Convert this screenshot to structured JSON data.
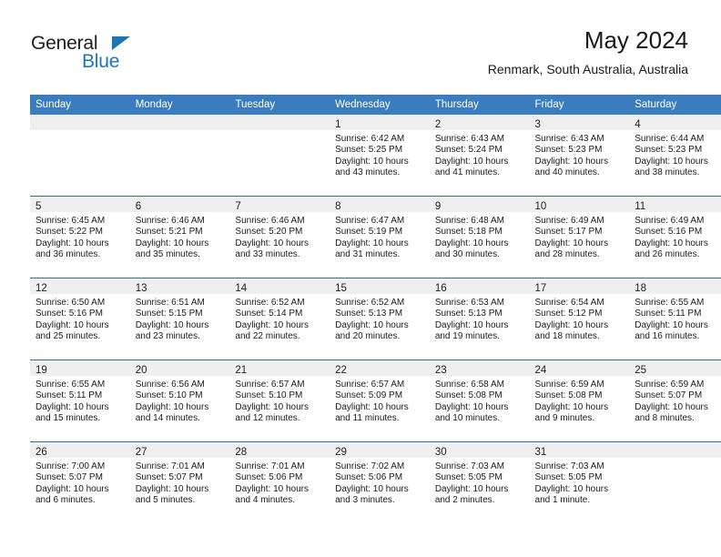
{
  "brand": {
    "name_part1": "General",
    "name_part2": "Blue",
    "logo_icon": "triangle-flag-icon",
    "accent_color": "#1b75bb"
  },
  "header": {
    "month_title": "May 2024",
    "location": "Renmark, South Australia, Australia"
  },
  "theme": {
    "header_row_bg": "#3a7cbe",
    "row_divider": "#2e6da4",
    "daynum_band_bg": "#efefef"
  },
  "calendar": {
    "weekday_headers": [
      "Sunday",
      "Monday",
      "Tuesday",
      "Wednesday",
      "Thursday",
      "Friday",
      "Saturday"
    ],
    "weeks": [
      [
        {
          "day": "",
          "sunrise": "",
          "sunset": "",
          "daylight_line1": "",
          "daylight_line2": ""
        },
        {
          "day": "",
          "sunrise": "",
          "sunset": "",
          "daylight_line1": "",
          "daylight_line2": ""
        },
        {
          "day": "",
          "sunrise": "",
          "sunset": "",
          "daylight_line1": "",
          "daylight_line2": ""
        },
        {
          "day": "1",
          "sunrise": "Sunrise: 6:42 AM",
          "sunset": "Sunset: 5:25 PM",
          "daylight_line1": "Daylight: 10 hours",
          "daylight_line2": "and 43 minutes."
        },
        {
          "day": "2",
          "sunrise": "Sunrise: 6:43 AM",
          "sunset": "Sunset: 5:24 PM",
          "daylight_line1": "Daylight: 10 hours",
          "daylight_line2": "and 41 minutes."
        },
        {
          "day": "3",
          "sunrise": "Sunrise: 6:43 AM",
          "sunset": "Sunset: 5:23 PM",
          "daylight_line1": "Daylight: 10 hours",
          "daylight_line2": "and 40 minutes."
        },
        {
          "day": "4",
          "sunrise": "Sunrise: 6:44 AM",
          "sunset": "Sunset: 5:23 PM",
          "daylight_line1": "Daylight: 10 hours",
          "daylight_line2": "and 38 minutes."
        }
      ],
      [
        {
          "day": "5",
          "sunrise": "Sunrise: 6:45 AM",
          "sunset": "Sunset: 5:22 PM",
          "daylight_line1": "Daylight: 10 hours",
          "daylight_line2": "and 36 minutes."
        },
        {
          "day": "6",
          "sunrise": "Sunrise: 6:46 AM",
          "sunset": "Sunset: 5:21 PM",
          "daylight_line1": "Daylight: 10 hours",
          "daylight_line2": "and 35 minutes."
        },
        {
          "day": "7",
          "sunrise": "Sunrise: 6:46 AM",
          "sunset": "Sunset: 5:20 PM",
          "daylight_line1": "Daylight: 10 hours",
          "daylight_line2": "and 33 minutes."
        },
        {
          "day": "8",
          "sunrise": "Sunrise: 6:47 AM",
          "sunset": "Sunset: 5:19 PM",
          "daylight_line1": "Daylight: 10 hours",
          "daylight_line2": "and 31 minutes."
        },
        {
          "day": "9",
          "sunrise": "Sunrise: 6:48 AM",
          "sunset": "Sunset: 5:18 PM",
          "daylight_line1": "Daylight: 10 hours",
          "daylight_line2": "and 30 minutes."
        },
        {
          "day": "10",
          "sunrise": "Sunrise: 6:49 AM",
          "sunset": "Sunset: 5:17 PM",
          "daylight_line1": "Daylight: 10 hours",
          "daylight_line2": "and 28 minutes."
        },
        {
          "day": "11",
          "sunrise": "Sunrise: 6:49 AM",
          "sunset": "Sunset: 5:16 PM",
          "daylight_line1": "Daylight: 10 hours",
          "daylight_line2": "and 26 minutes."
        }
      ],
      [
        {
          "day": "12",
          "sunrise": "Sunrise: 6:50 AM",
          "sunset": "Sunset: 5:16 PM",
          "daylight_line1": "Daylight: 10 hours",
          "daylight_line2": "and 25 minutes."
        },
        {
          "day": "13",
          "sunrise": "Sunrise: 6:51 AM",
          "sunset": "Sunset: 5:15 PM",
          "daylight_line1": "Daylight: 10 hours",
          "daylight_line2": "and 23 minutes."
        },
        {
          "day": "14",
          "sunrise": "Sunrise: 6:52 AM",
          "sunset": "Sunset: 5:14 PM",
          "daylight_line1": "Daylight: 10 hours",
          "daylight_line2": "and 22 minutes."
        },
        {
          "day": "15",
          "sunrise": "Sunrise: 6:52 AM",
          "sunset": "Sunset: 5:13 PM",
          "daylight_line1": "Daylight: 10 hours",
          "daylight_line2": "and 20 minutes."
        },
        {
          "day": "16",
          "sunrise": "Sunrise: 6:53 AM",
          "sunset": "Sunset: 5:13 PM",
          "daylight_line1": "Daylight: 10 hours",
          "daylight_line2": "and 19 minutes."
        },
        {
          "day": "17",
          "sunrise": "Sunrise: 6:54 AM",
          "sunset": "Sunset: 5:12 PM",
          "daylight_line1": "Daylight: 10 hours",
          "daylight_line2": "and 18 minutes."
        },
        {
          "day": "18",
          "sunrise": "Sunrise: 6:55 AM",
          "sunset": "Sunset: 5:11 PM",
          "daylight_line1": "Daylight: 10 hours",
          "daylight_line2": "and 16 minutes."
        }
      ],
      [
        {
          "day": "19",
          "sunrise": "Sunrise: 6:55 AM",
          "sunset": "Sunset: 5:11 PM",
          "daylight_line1": "Daylight: 10 hours",
          "daylight_line2": "and 15 minutes."
        },
        {
          "day": "20",
          "sunrise": "Sunrise: 6:56 AM",
          "sunset": "Sunset: 5:10 PM",
          "daylight_line1": "Daylight: 10 hours",
          "daylight_line2": "and 14 minutes."
        },
        {
          "day": "21",
          "sunrise": "Sunrise: 6:57 AM",
          "sunset": "Sunset: 5:10 PM",
          "daylight_line1": "Daylight: 10 hours",
          "daylight_line2": "and 12 minutes."
        },
        {
          "day": "22",
          "sunrise": "Sunrise: 6:57 AM",
          "sunset": "Sunset: 5:09 PM",
          "daylight_line1": "Daylight: 10 hours",
          "daylight_line2": "and 11 minutes."
        },
        {
          "day": "23",
          "sunrise": "Sunrise: 6:58 AM",
          "sunset": "Sunset: 5:08 PM",
          "daylight_line1": "Daylight: 10 hours",
          "daylight_line2": "and 10 minutes."
        },
        {
          "day": "24",
          "sunrise": "Sunrise: 6:59 AM",
          "sunset": "Sunset: 5:08 PM",
          "daylight_line1": "Daylight: 10 hours",
          "daylight_line2": "and 9 minutes."
        },
        {
          "day": "25",
          "sunrise": "Sunrise: 6:59 AM",
          "sunset": "Sunset: 5:07 PM",
          "daylight_line1": "Daylight: 10 hours",
          "daylight_line2": "and 8 minutes."
        }
      ],
      [
        {
          "day": "26",
          "sunrise": "Sunrise: 7:00 AM",
          "sunset": "Sunset: 5:07 PM",
          "daylight_line1": "Daylight: 10 hours",
          "daylight_line2": "and 6 minutes."
        },
        {
          "day": "27",
          "sunrise": "Sunrise: 7:01 AM",
          "sunset": "Sunset: 5:07 PM",
          "daylight_line1": "Daylight: 10 hours",
          "daylight_line2": "and 5 minutes."
        },
        {
          "day": "28",
          "sunrise": "Sunrise: 7:01 AM",
          "sunset": "Sunset: 5:06 PM",
          "daylight_line1": "Daylight: 10 hours",
          "daylight_line2": "and 4 minutes."
        },
        {
          "day": "29",
          "sunrise": "Sunrise: 7:02 AM",
          "sunset": "Sunset: 5:06 PM",
          "daylight_line1": "Daylight: 10 hours",
          "daylight_line2": "and 3 minutes."
        },
        {
          "day": "30",
          "sunrise": "Sunrise: 7:03 AM",
          "sunset": "Sunset: 5:05 PM",
          "daylight_line1": "Daylight: 10 hours",
          "daylight_line2": "and 2 minutes."
        },
        {
          "day": "31",
          "sunrise": "Sunrise: 7:03 AM",
          "sunset": "Sunset: 5:05 PM",
          "daylight_line1": "Daylight: 10 hours",
          "daylight_line2": "and 1 minute."
        },
        {
          "day": "",
          "sunrise": "",
          "sunset": "",
          "daylight_line1": "",
          "daylight_line2": ""
        }
      ]
    ]
  }
}
